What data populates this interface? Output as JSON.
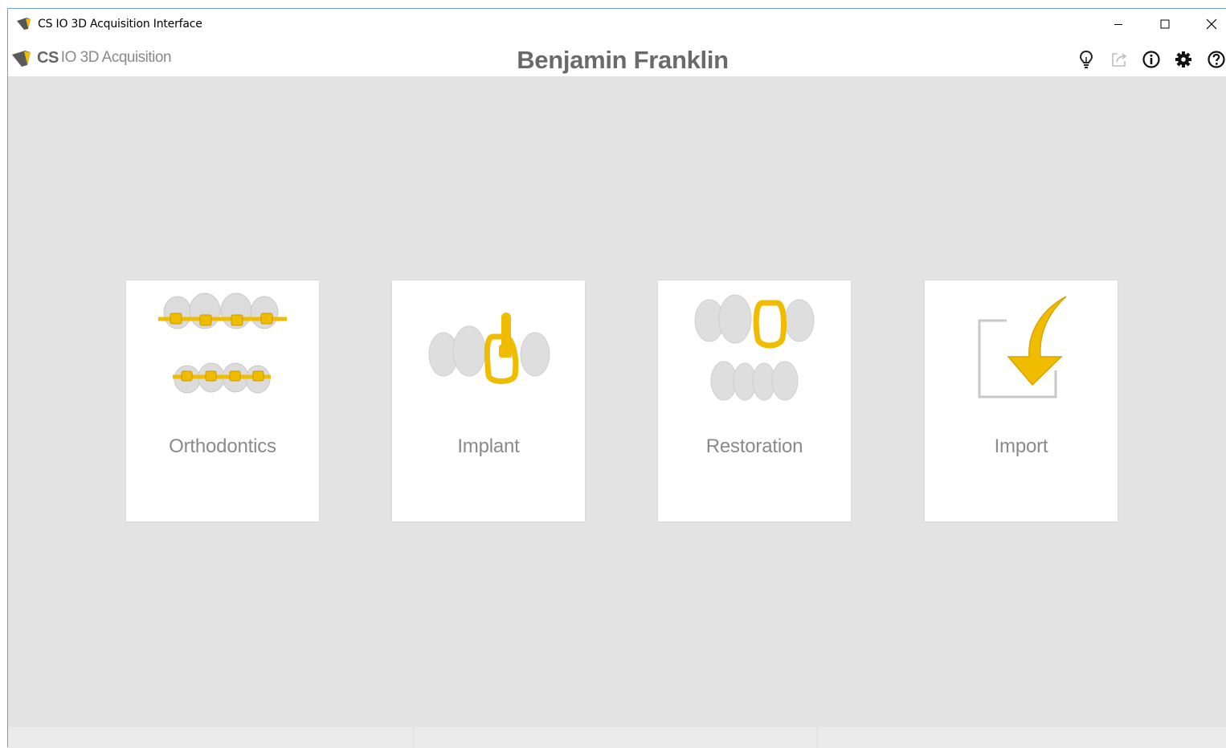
{
  "window": {
    "title": "CS IO 3D Acquisition Interface"
  },
  "header": {
    "logo_brand": "CS",
    "logo_product": "IO 3D Acquisition",
    "patient_name": "Benjamin Franklin",
    "icons": [
      "lightbulb-icon",
      "export-icon",
      "info-icon",
      "gear-icon",
      "help-icon"
    ]
  },
  "cards": [
    {
      "label": "Orthodontics",
      "icon": "orthodontics-icon"
    },
    {
      "label": "Implant",
      "icon": "implant-icon"
    },
    {
      "label": "Restoration",
      "icon": "restoration-icon"
    },
    {
      "label": "Import",
      "icon": "import-icon"
    }
  ],
  "colors": {
    "accent": "#f0bc00",
    "workspace_bg": "#e3e3e3",
    "label_text": "#8a8a8a"
  }
}
